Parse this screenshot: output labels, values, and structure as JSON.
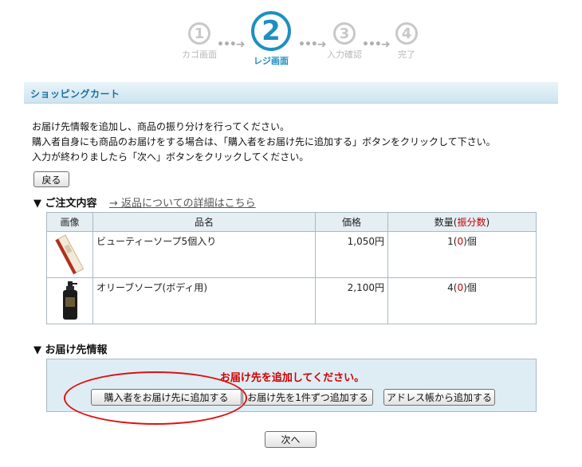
{
  "steps": [
    {
      "number": "1",
      "label": "カゴ画面"
    },
    {
      "number": "2",
      "label": "レジ画面"
    },
    {
      "number": "3",
      "label": "入力確認"
    },
    {
      "number": "4",
      "label": "完了"
    }
  ],
  "step_arrow": "•••➜",
  "section_title": "ショッピングカート",
  "instructions": [
    "お届け先情報を追加し、商品の振り分けを行ってください。",
    "購入者自身にも商品のお届けをする場合は、「購入者をお届け先に追加する」ボタンをクリックして下さい。",
    "入力が終わりましたら「次へ」ボタンをクリックしてください。"
  ],
  "back_button": "戻る",
  "order_heading": "▼ ご注文内容",
  "returns_link": "→ 返品についての詳細はこちら",
  "table": {
    "headers": {
      "image": "画像",
      "name": "品名",
      "price": "価格",
      "qty_prefix": "数量(",
      "qty_red": "振分数",
      "qty_suffix": ")"
    },
    "rows": [
      {
        "name": "ビューティーソープ5個入り",
        "price": "1,050円",
        "qty": "1",
        "alloc": "0",
        "unit": "個",
        "image_icon": "soap-box-image"
      },
      {
        "name": "オリーブソープ(ボディ用)",
        "price": "2,100円",
        "qty": "4",
        "alloc": "0",
        "unit": "個",
        "image_icon": "soap-bottle-image"
      }
    ]
  },
  "shipping_heading": "▼ お届け先情報",
  "shipping_message": "お届け先を追加してください。",
  "shipping_buttons": {
    "add_buyer": "購入者をお届け先に追加する",
    "add_one": "お届け先を1件ずつ追加する",
    "add_address_book": "アドレス帳から追加する"
  },
  "next_button": "次へ",
  "colors": {
    "accent": "#1f8fc0",
    "inactive": "#c8c8c8",
    "alert": "#d00000",
    "annotation": "#e01010"
  }
}
